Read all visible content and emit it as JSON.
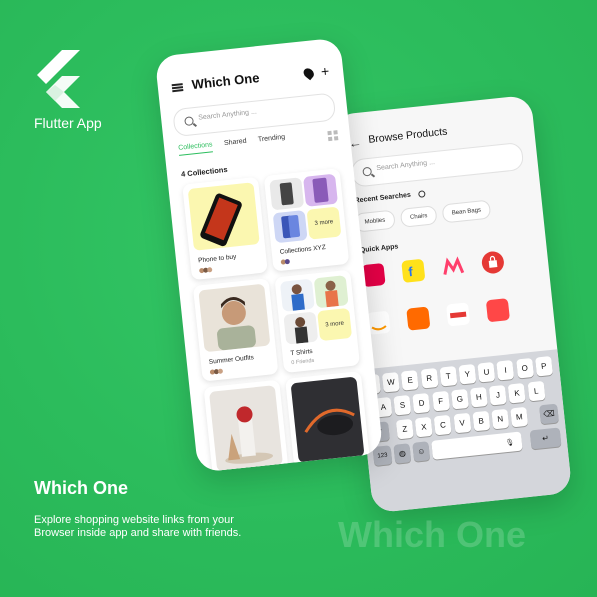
{
  "brand": {
    "name": "Flutter App"
  },
  "promo": {
    "title": "Which One",
    "description": "Explore shopping website links from your Browser inside app and share with friends.",
    "watermark": "Which One"
  },
  "colors": {
    "accent": "#2dbe5e",
    "background": "#2dbe5e"
  },
  "home_screen": {
    "title": "Which One",
    "search_placeholder": "Search Anything ...",
    "tabs": [
      {
        "label": "Collections",
        "active": true
      },
      {
        "label": "Shared",
        "active": false
      },
      {
        "label": "Trending",
        "active": false
      }
    ],
    "collections_count": "4 Collections",
    "collections": [
      {
        "name": "Phone to buy",
        "more": ""
      },
      {
        "name": "Collections XYZ",
        "more": "3 more"
      },
      {
        "name": "Summer Outfits",
        "more": ""
      },
      {
        "name": "T Shirts",
        "subtitle": "0 Friends",
        "more": "3 more"
      }
    ]
  },
  "browse_screen": {
    "title": "Browse Products",
    "search_placeholder": "Search Anything ...",
    "recent_label": "Recent Searches",
    "recent_chips": [
      "Mobiles",
      "Chairs",
      "Bean Bags"
    ],
    "quick_apps_label": "Quick Apps",
    "quick_apps": [
      {
        "name": "snapdeal",
        "color": "#e40046"
      },
      {
        "name": "flipkart",
        "color": "#2874f0"
      },
      {
        "name": "myntra",
        "color": "#ff3f6c"
      },
      {
        "name": "shopping-bag",
        "color": "#e53935"
      },
      {
        "name": "amazon",
        "color": "#ffffff"
      },
      {
        "name": "alibaba",
        "color": "#ff6a00"
      },
      {
        "name": "mall",
        "color": "#ffffff"
      },
      {
        "name": "aliexpress",
        "color": "#ff4747"
      }
    ],
    "keyboard": {
      "row1": [
        "Q",
        "W",
        "E",
        "R",
        "T",
        "Y",
        "U",
        "I",
        "O",
        "P"
      ],
      "row2": [
        "A",
        "S",
        "D",
        "F",
        "G",
        "H",
        "J",
        "K",
        "L"
      ],
      "row3": [
        "Z",
        "X",
        "C",
        "V",
        "B",
        "N",
        "M"
      ],
      "numbers_key": "123"
    }
  }
}
